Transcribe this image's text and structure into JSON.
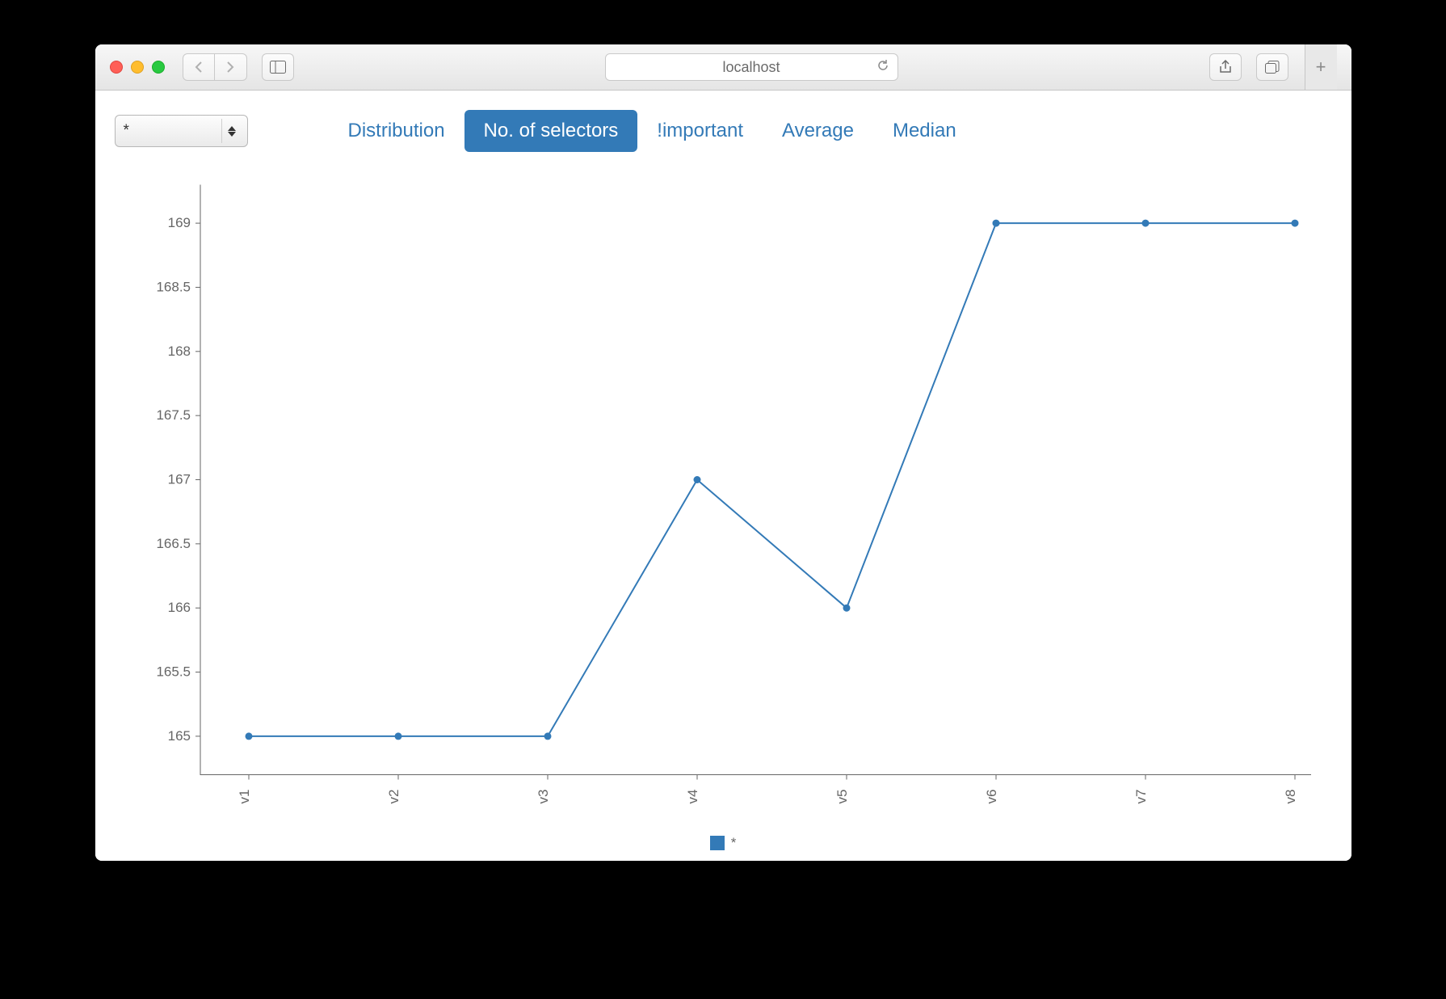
{
  "browser": {
    "url_display": "localhost"
  },
  "selector": {
    "value": "*"
  },
  "tabs": [
    {
      "label": "Distribution",
      "active": false
    },
    {
      "label": "No. of selectors",
      "active": true
    },
    {
      "label": "!important",
      "active": false
    },
    {
      "label": "Average",
      "active": false
    },
    {
      "label": "Median",
      "active": false
    }
  ],
  "legend": {
    "label": "*"
  },
  "chart_data": {
    "type": "line",
    "categories": [
      "v1",
      "v2",
      "v3",
      "v4",
      "v5",
      "v6",
      "v7",
      "v8"
    ],
    "series": [
      {
        "name": "*",
        "values": [
          165,
          165,
          165,
          167,
          166,
          169,
          169,
          169
        ]
      }
    ],
    "y_ticks": [
      165,
      165.5,
      166,
      166.5,
      167,
      167.5,
      168,
      168.5,
      169
    ],
    "ylim": [
      164.7,
      169.3
    ],
    "xlabel": "",
    "ylabel": "",
    "title": ""
  }
}
